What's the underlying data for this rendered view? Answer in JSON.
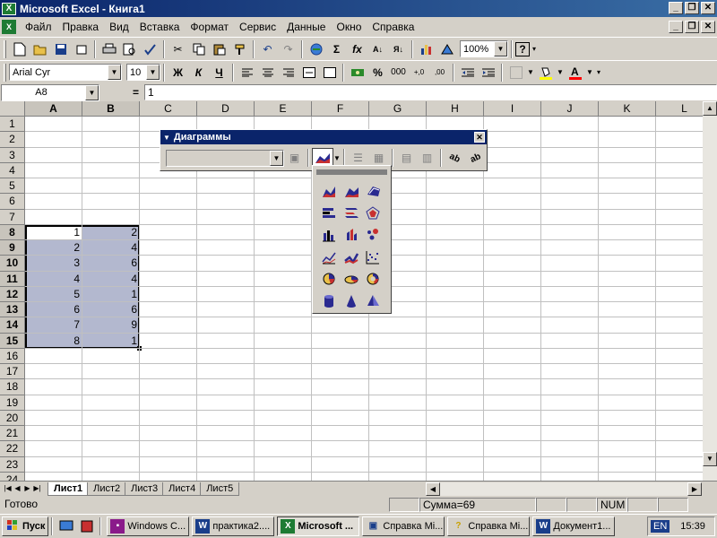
{
  "window": {
    "title": "Microsoft Excel - Книга1",
    "min": "_",
    "restore": "❐",
    "close": "✕"
  },
  "menu": {
    "items": [
      "Файл",
      "Правка",
      "Вид",
      "Вставка",
      "Формат",
      "Сервис",
      "Данные",
      "Окно",
      "Справка"
    ]
  },
  "toolbar": {
    "zoom": "100%",
    "font": "Arial Cyr",
    "size": "10",
    "bold": "Ж",
    "italic": "К",
    "underline": "Ч",
    "percent": "%",
    "thousands": "000",
    "sigma": "Σ",
    "fx": "fx",
    "help": "?"
  },
  "formula_bar": {
    "name_box": "A8",
    "equals": "=",
    "value": "1"
  },
  "columns": [
    "A",
    "B",
    "C",
    "D",
    "E",
    "F",
    "G",
    "H",
    "I",
    "J",
    "K",
    "L"
  ],
  "rows": [
    "1",
    "2",
    "3",
    "4",
    "5",
    "6",
    "7",
    "8",
    "9",
    "10",
    "11",
    "12",
    "13",
    "14",
    "15",
    "16",
    "17",
    "18",
    "19",
    "20",
    "21",
    "22",
    "23",
    "24"
  ],
  "cells": {
    "A": [
      "1",
      "2",
      "3",
      "4",
      "5",
      "6",
      "7",
      "8"
    ],
    "B": [
      "2",
      "4",
      "6",
      "4",
      "1",
      "6",
      "9",
      "1"
    ]
  },
  "chart_toolbar": {
    "title": "Диаграммы",
    "close": "✕"
  },
  "chart_types_popup": {
    "icons": [
      "area-chart-icon",
      "3d-area-chart-icon",
      "3d-surface-chart-icon",
      "bar-chart-icon",
      "3d-bar-chart-icon",
      "radar-chart-icon",
      "column-chart-icon",
      "3d-column-chart-icon",
      "bubble-chart-icon",
      "line-chart-icon",
      "3d-line-chart-icon",
      "scatter-chart-icon",
      "pie-chart-icon",
      "3d-pie-chart-icon",
      "doughnut-chart-icon",
      "cylinder-chart-icon",
      "cone-chart-icon",
      "pyramid-chart-icon"
    ]
  },
  "sheets": {
    "tabs": [
      "Лист1",
      "Лист2",
      "Лист3",
      "Лист4",
      "Лист5"
    ],
    "active": "Лист1"
  },
  "status": {
    "ready": "Готово",
    "sum": "Сумма=69",
    "num": "NUM"
  },
  "taskbar": {
    "start": "Пуск",
    "buttons": [
      "Windows C...",
      "практика2....",
      "Microsoft ...",
      "Справка Mi...",
      "Справка Mi...",
      "Документ1..."
    ],
    "lang": "EN",
    "clock": "15:39"
  },
  "colors": {
    "title_bar": "#0a246a",
    "selection": "#b3b8cf",
    "excel_green": "#1e7b34"
  }
}
